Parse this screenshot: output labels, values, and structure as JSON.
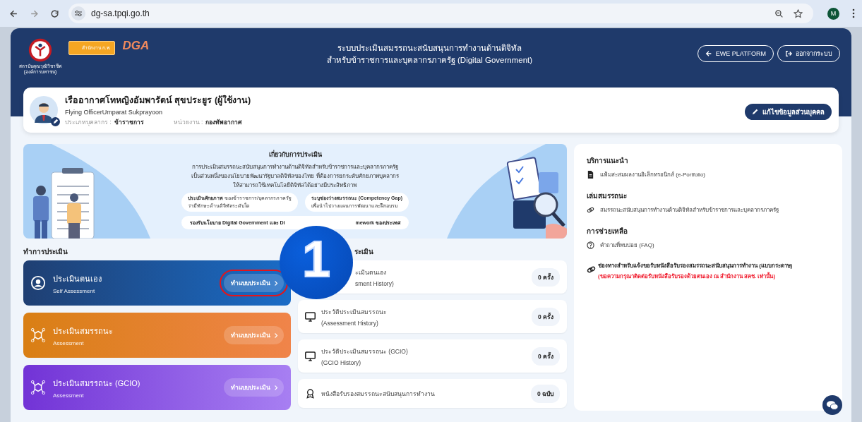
{
  "browser": {
    "url": "dg-sa.tpqi.go.th",
    "profile_initial": "M"
  },
  "header": {
    "org_caption": [
      "สถาบันคุณวุฒิวิชาชีพ",
      "(องค์การมหาชน)"
    ],
    "ocsc_logo": "สำนักงาน ก.พ.",
    "dga_logo": "DGA",
    "title": [
      "ระบบประเมินสมรรถนะสนับสนุนการทำงานด้านดิจิทัล",
      "สำหรับข้าราชการและบุคลากรภาครัฐ (Digital Government)"
    ],
    "buttons": [
      {
        "kind": "back",
        "label": "EWE PLATFORM"
      },
      {
        "kind": "logout",
        "label": "ออกจากระบบ"
      }
    ]
  },
  "profile": {
    "name": "เรืออากาศโทหญิงอัมพารัตน์ สุขประยูร (ผู้ใช้งาน)",
    "name_en": "Flying OfficerUmparat Sukprayoon",
    "fields": [
      {
        "label": "ประเภทบุคลากร :",
        "value": "ข้าราชการ"
      },
      {
        "label": "หน่วยงาน :",
        "value": "กองทัพอากาศ"
      }
    ],
    "edit_button": "แก้ไขข้อมูลส่วนบุคคล"
  },
  "banner": {
    "title": "เกี่ยวกับการประเมิน",
    "lines": [
      "การประเมินสมรรถนะสนับสนุนการทำงานด้านดิจิทัลสำหรับข้าราชการและบุคลากรภาครัฐ",
      "เป็นส่วนหนึ่งของนโยบายพัฒนารัฐบาลดิจิทัลของไทย ที่ต้องการยกระดับศักยภาพบุคลากร",
      "ให้สามารถใช้เทคโนโลยีดิจิทัลได้อย่างมีประสิทธิภาพ"
    ],
    "chips": [
      {
        "lines": [
          "**ประเมินศักยภาพ** ของข้าราชการ/บุคลากรภาครัฐ",
          "ว่ามีทักษะด้านดิจิทัลระดับใด"
        ]
      },
      {
        "lines": [
          "**ระบุช่องว่างสมรรถนะ (Competency Gap)**",
          "เพื่อนำไปวางแผนการพัฒนาและฝึกอบรม"
        ]
      }
    ],
    "wide_chip": [
      "รองรับนโยบาย Digital Government และ Di",
      "mework ของประเทศ"
    ]
  },
  "assess": {
    "title": "ทำการประเมิน",
    "cards": [
      {
        "kind": "self",
        "title": "ประเมินตนเอง",
        "subtitle": "Self Assessment",
        "button": "ทำแบบประเมิน",
        "highlighted": true
      },
      {
        "kind": "competency",
        "title": "ประเมินสมรรถนะ",
        "subtitle": "Assessment",
        "button": "ทำแบบประเมิน",
        "highlighted": false
      },
      {
        "kind": "gcio",
        "title": "ประเมินสมรรถนะ (GCIO)",
        "subtitle": "Assessment",
        "button": "ทำแบบประเมิน",
        "highlighted": false
      }
    ]
  },
  "history": {
    "title": "ระเมิน",
    "items": [
      {
        "kind": "self_history",
        "lines": [
          "ะเมินตนเอง",
          "sment History)"
        ],
        "count": "0 ครั้ง"
      },
      {
        "kind": "competency_history",
        "lines": [
          "ประวัติประเมินสมรรถนะ",
          "(Assessment History)"
        ],
        "count": "0 ครั้ง"
      },
      {
        "kind": "gcio_history",
        "lines": [
          "ประวัติประเมินสมรรถนะ (GCIO)",
          "(GCIO History)"
        ],
        "count": "0 ครั้ง"
      },
      {
        "kind": "certificate",
        "lines": [
          "หนังสือรับรองสมรรถนะสนับสนุนการทำงาน"
        ],
        "count": "0 ฉบับ"
      }
    ]
  },
  "side": {
    "sections": [
      {
        "title": "บริการแนะนำ",
        "items": [
          {
            "kind": "portfolio",
            "text": "แฟ้มสะสมผลงานอิเล็กทรอนิกส์ (e-Portfolio)"
          }
        ]
      },
      {
        "title": "เล่มสมรรถนะ",
        "items": [
          {
            "kind": "competency_book",
            "text": "สมรรถนะสนับสนุนการทำงานด้านดิจิทัลสำหรับข้าราชการและบุคลากรภาครัฐ"
          }
        ]
      },
      {
        "title": "การช่วยเหลือ",
        "items": [
          {
            "kind": "faq",
            "text": "คำถามที่พบบ่อย (FAQ)"
          }
        ]
      }
    ],
    "notice": {
      "title": "ช่องทางสำหรับแจ้งขอรับหนังสือรับรองสมรรถนะสนับสนุนการทำงาน (แบบกระดาษ)",
      "warning": "(ขอความกรุณาติดต่อรับหนังสือรับรองด้วยตนเอง ณ สำนักงาน สคช. เท่านั้น)"
    }
  },
  "callout": {
    "label": "1"
  }
}
